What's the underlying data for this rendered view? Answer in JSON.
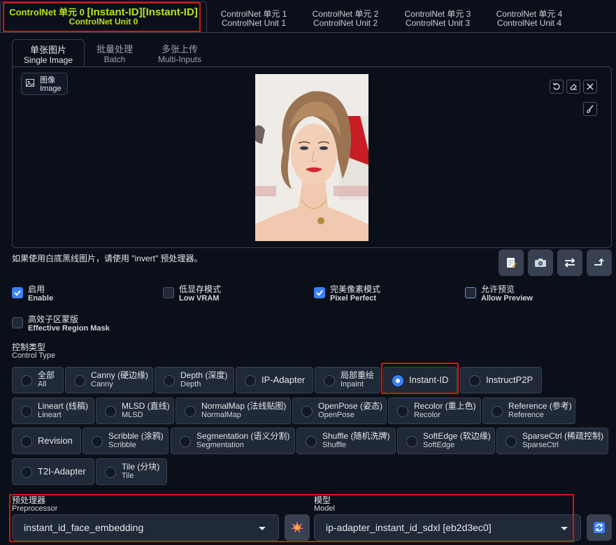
{
  "unit_tabs": [
    {
      "l1": "ControlNet 单元 0",
      "hl": "[Instant-ID][Instant-ID]",
      "l2": "ControlNet Unit 0"
    },
    {
      "l1": "ControlNet 单元 1",
      "l2": "ControlNet Unit 1"
    },
    {
      "l1": "ControlNet 单元 2",
      "l2": "ControlNet Unit 2"
    },
    {
      "l1": "ControlNet 单元 3",
      "l2": "ControlNet Unit 3"
    },
    {
      "l1": "ControlNet 单元 4",
      "l2": "ControlNet Unit 4"
    }
  ],
  "sub_tabs": [
    {
      "l1": "单张图片",
      "l2": "Single Image"
    },
    {
      "l1": "批量处理",
      "l2": "Batch"
    },
    {
      "l1": "多张上传",
      "l2": "Multi-Inputs"
    }
  ],
  "image_panel": {
    "label_l1": "图像",
    "label_l2": "Image"
  },
  "hint": "如果使用白底黑线图片，请使用 \"invert\" 预处理器。",
  "checkboxes": [
    {
      "l1": "启用",
      "l2": "Enable",
      "checked": true
    },
    {
      "l1": "低显存模式",
      "l2": "Low VRAM",
      "checked": false
    },
    {
      "l1": "完美像素模式",
      "l2": "Pixel Perfect",
      "checked": true
    },
    {
      "l1": "允许预览",
      "l2": "Allow Preview",
      "checked": false
    },
    {
      "l1": "高效子区蒙版",
      "l2": "Effective Region Mask",
      "checked": false
    }
  ],
  "control_type": {
    "l1": "控制类型",
    "l2": "Control Type",
    "selected": "Instant-ID",
    "options": [
      {
        "l1": "全部",
        "l2": "All"
      },
      {
        "l1": "Canny (硬边缘)",
        "l2": "Canny"
      },
      {
        "l1": "Depth (深度)",
        "l2": "Depth"
      },
      {
        "l1": "IP-Adapter",
        "l2": ""
      },
      {
        "l1": "局部重绘",
        "l2": "Inpaint"
      },
      {
        "l1": "Instant-ID",
        "l2": ""
      },
      {
        "l1": "InstructP2P",
        "l2": ""
      },
      {
        "l1": "Lineart (线稿)",
        "l2": "Lineart"
      },
      {
        "l1": "MLSD (直线)",
        "l2": "MLSD"
      },
      {
        "l1": "NormalMap (法线贴图)",
        "l2": "NormalMap"
      },
      {
        "l1": "OpenPose (姿态)",
        "l2": "OpenPose"
      },
      {
        "l1": "Recolor (重上色)",
        "l2": "Recolor"
      },
      {
        "l1": "Reference (参考)",
        "l2": "Reference"
      },
      {
        "l1": "Revision",
        "l2": ""
      },
      {
        "l1": "Scribble (涂鸦)",
        "l2": "Scribble"
      },
      {
        "l1": "Segmentation (语义分割)",
        "l2": "Segmentation"
      },
      {
        "l1": "Shuffle (随机洗牌)",
        "l2": "Shuffle"
      },
      {
        "l1": "SoftEdge (软边缘)",
        "l2": "SoftEdge"
      },
      {
        "l1": "SparseCtrl (稀疏控制)",
        "l2": "SparseCtrl"
      },
      {
        "l1": "T2I-Adapter",
        "l2": ""
      },
      {
        "l1": "Tile (分块)",
        "l2": "Tile"
      }
    ]
  },
  "preprocessor": {
    "l1": "预处理器",
    "l2": "Preprocessor",
    "value": "instant_id_face_embedding"
  },
  "model": {
    "l1": "模型",
    "l2": "Model",
    "value": "ip-adapter_instant_id_sdxl [eb2d3ec0]"
  },
  "icons": {
    "run_preprocessor": "explosion-icon",
    "refresh_models": "refresh-icon"
  },
  "colors": {
    "accent": "#3b82f6",
    "active_tab": "#b5e51d",
    "highlight_border": "#d0190c"
  }
}
